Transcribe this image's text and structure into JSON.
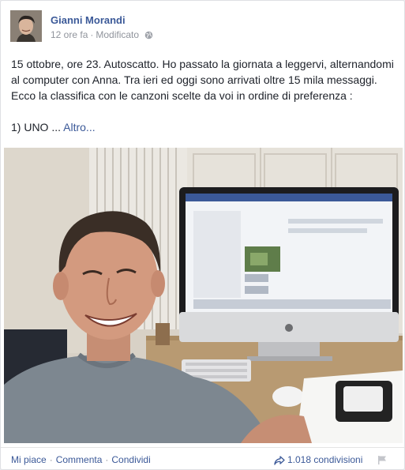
{
  "post": {
    "author": "Gianni Morandi",
    "time": "12 ore fa",
    "separator": "·",
    "status": "Modificato",
    "privacy_icon": "globe-icon",
    "lines": [
      "15 ottobre, ore 23. Autoscatto. Ho passato la giornata a leggervi, alternandomi",
      "al computer con Anna. Tra ieri ed oggi sono arrivati oltre 15 mila messaggi.",
      "Ecco la classifica con le canzoni scelte da voi in ordine di preferenza :"
    ],
    "teaser": "1) UNO ...",
    "more_label": "Altro..."
  },
  "footer": {
    "like_label": "Mi piace",
    "comment_label": "Commenta",
    "share_label": "Condividi",
    "separator": "·",
    "shares_count": "1.018 condivisioni",
    "share_icon": "share-arrow-icon",
    "flag_icon": "flag-icon"
  },
  "colors": {
    "link": "#3b5998",
    "meta": "#90949c",
    "text": "#1d2129",
    "background": "#e9eaed"
  }
}
